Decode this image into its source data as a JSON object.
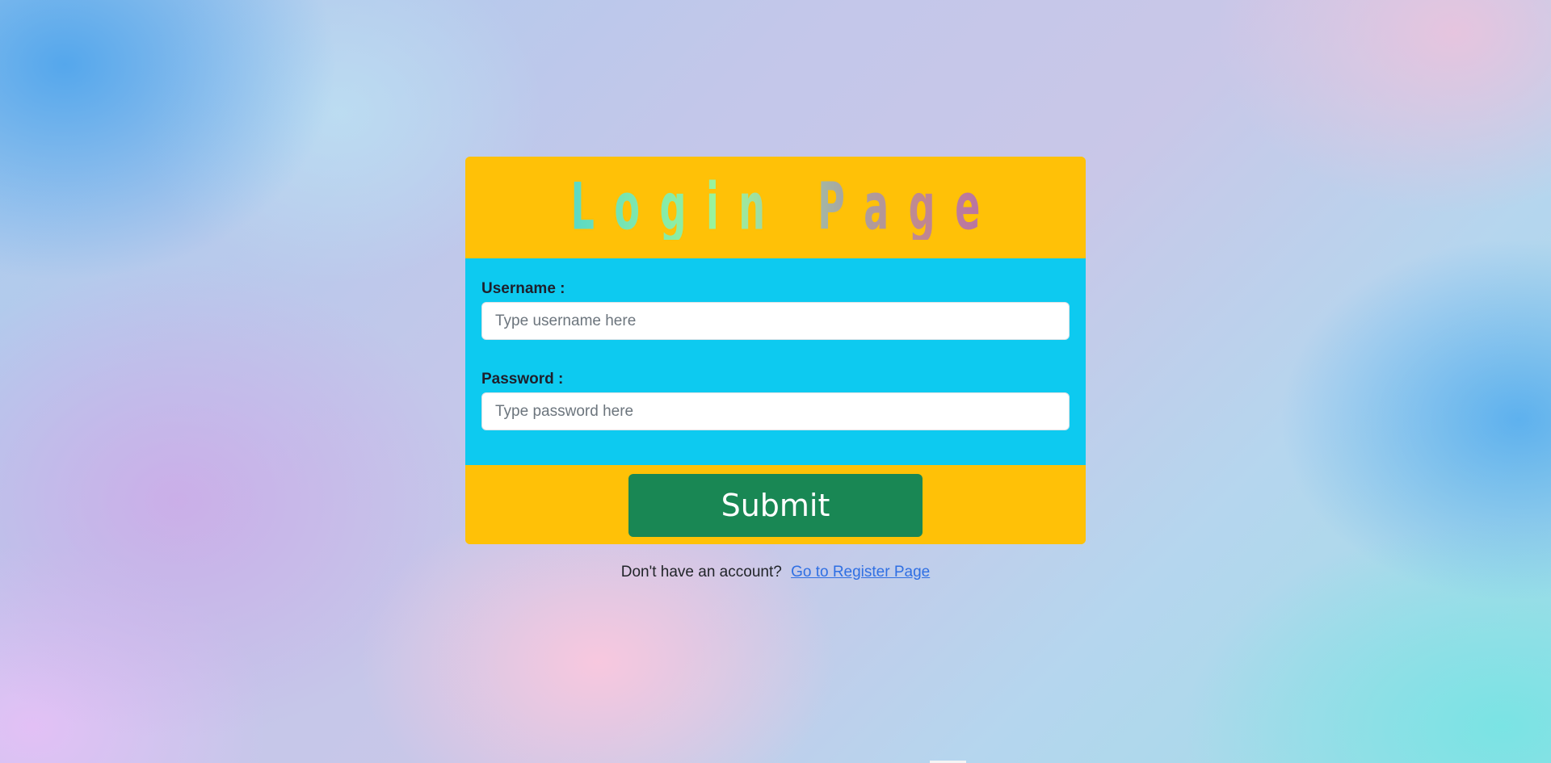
{
  "login_card": {
    "title": "Login Page",
    "username": {
      "label": "Username :",
      "placeholder": "Type username here",
      "value": ""
    },
    "password": {
      "label": "Password :",
      "placeholder": "Type password here",
      "value": ""
    },
    "submit_label": "Submit"
  },
  "footer": {
    "prompt": "Don't have an account?",
    "link_text": "Go to Register Page"
  },
  "colors": {
    "header_bg": "#ffc107",
    "body_bg": "#0dcaf0",
    "submit_bg": "#198754",
    "link": "#2f6fe3"
  }
}
